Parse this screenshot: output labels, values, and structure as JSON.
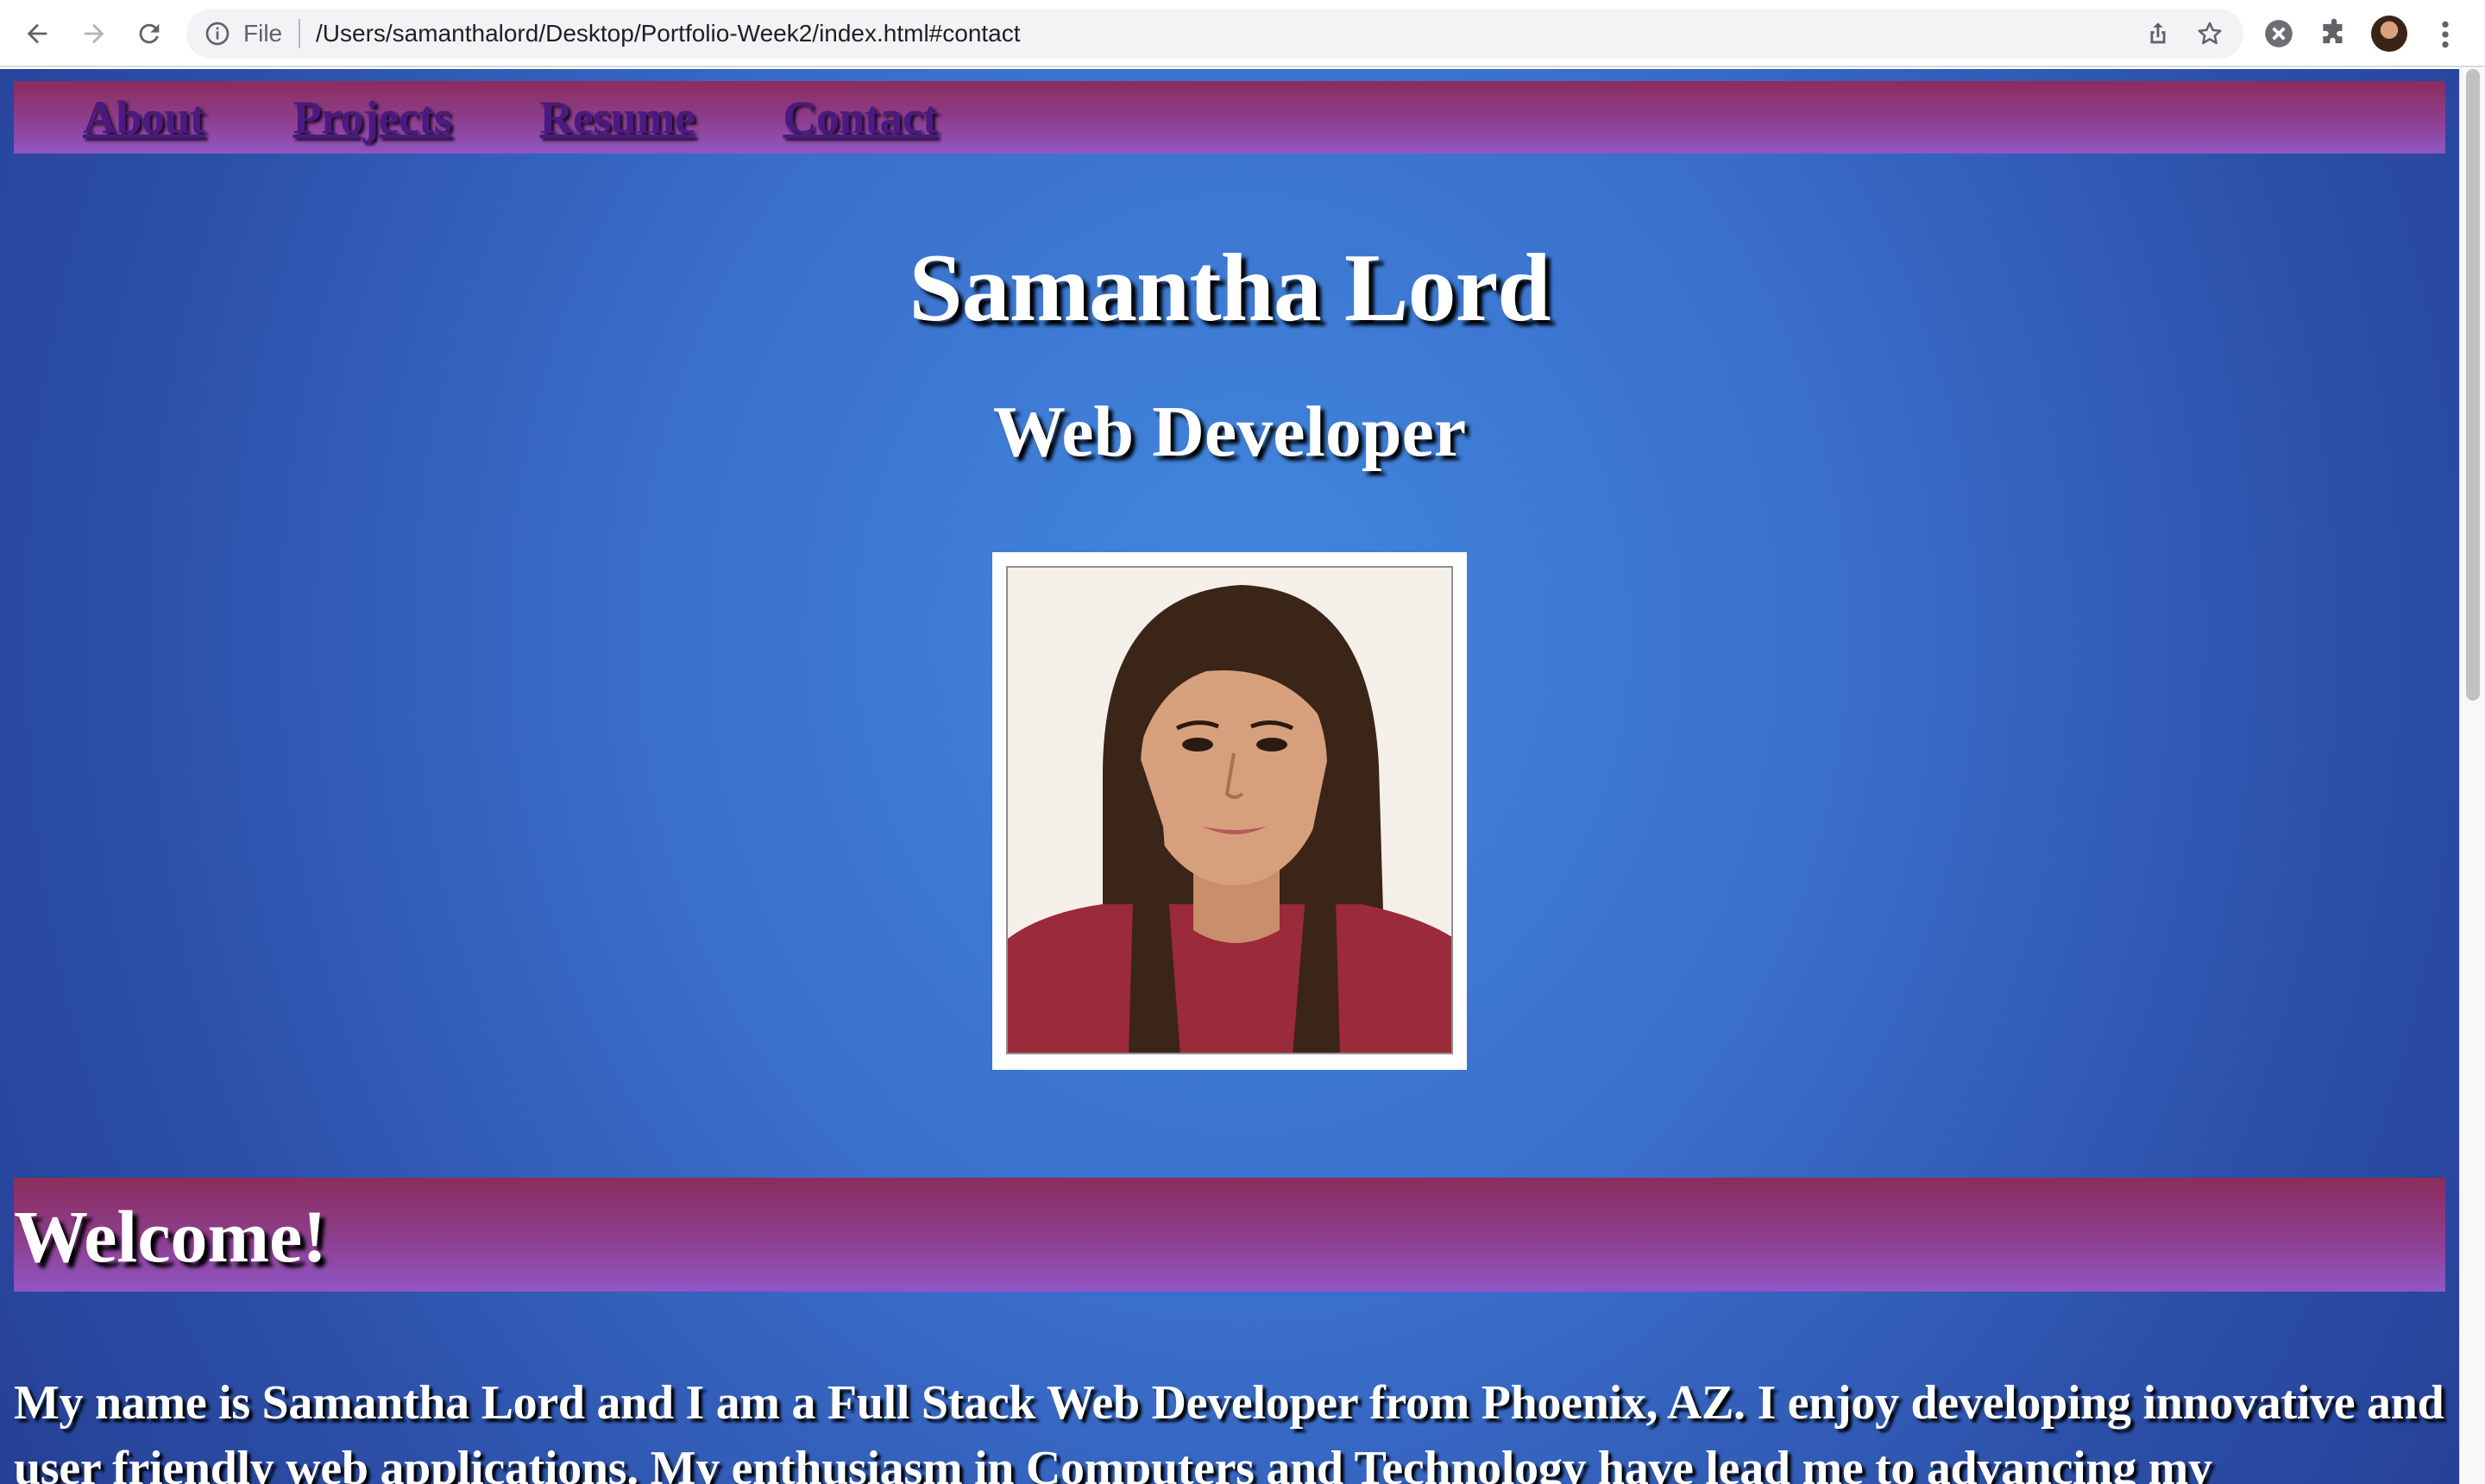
{
  "browser": {
    "scheme_label": "File",
    "url": "/Users/samanthalord/Desktop/Portfolio-Week2/index.html#contact",
    "icons": [
      "back-arrow-icon",
      "forward-arrow-icon",
      "reload-icon",
      "info-icon",
      "share-icon",
      "star-icon",
      "extension-x-icon",
      "puzzle-icon",
      "profile-avatar",
      "kebab-menu-icon"
    ]
  },
  "nav": {
    "items": [
      {
        "label": "About"
      },
      {
        "label": "Projects"
      },
      {
        "label": "Resume"
      },
      {
        "label": "Contact"
      }
    ]
  },
  "hero": {
    "name": "Samantha Lord",
    "role": "Web Developer"
  },
  "welcome": {
    "heading": "Welcome!",
    "intro": "My name is Samantha Lord and I am a Full Stack Web Developer from Phoenix, AZ. I enjoy developing innovative and user friendly web applications. My enthusiasm in Computers and Technology have lead me to advancing my"
  },
  "colors": {
    "page_gradient_center": "#4287de",
    "page_gradient_edge": "#253f94",
    "bar_top": "#8b2d5c",
    "bar_bottom": "#9156c4",
    "nav_link": "#4a1a82",
    "text": "#ffffff"
  }
}
